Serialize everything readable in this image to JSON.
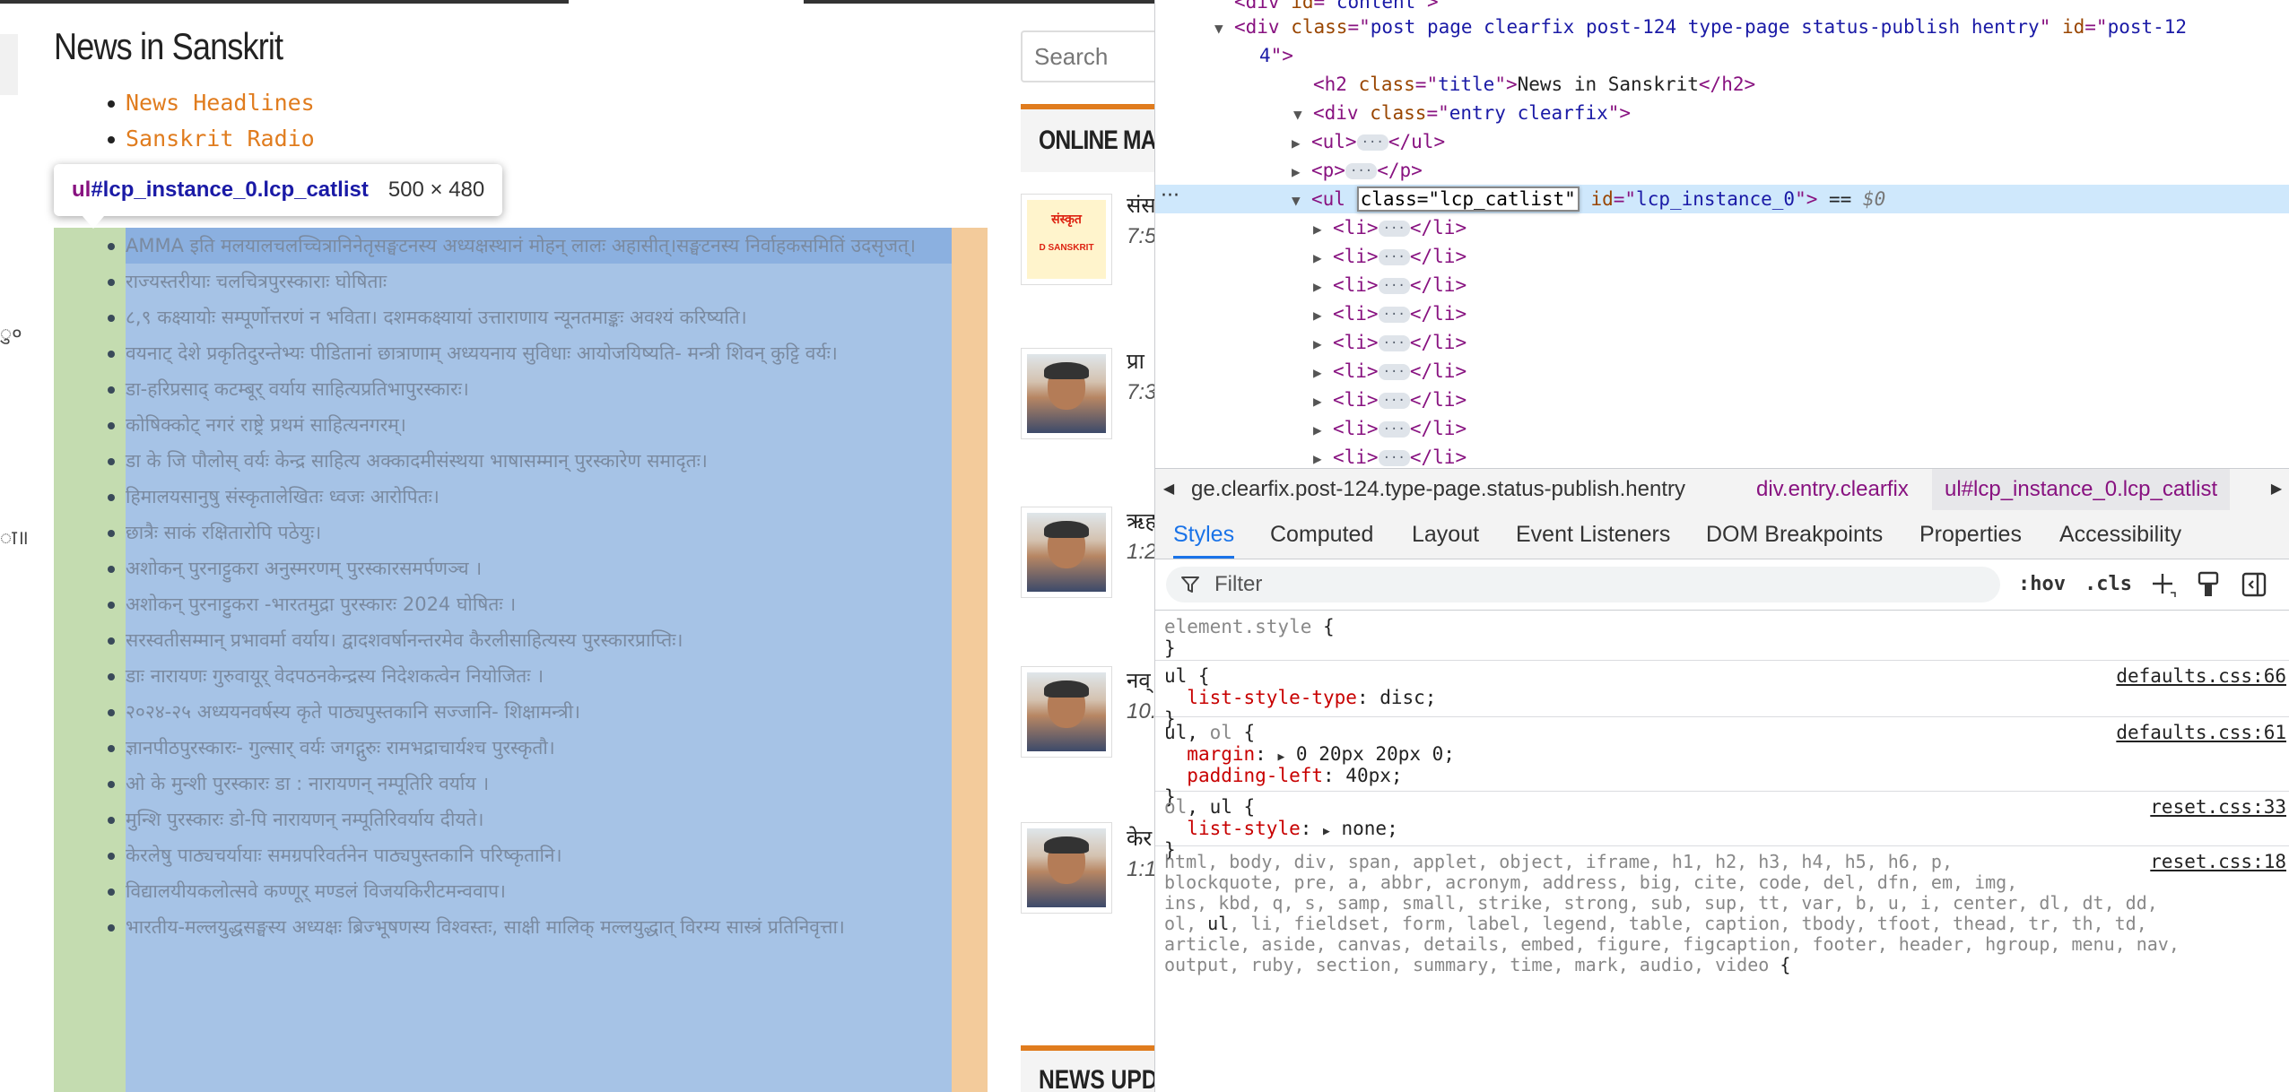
{
  "page": {
    "title": "News in Sanskrit",
    "top_links": [
      "News Headlines",
      "Sanskrit Radio"
    ],
    "edge_glyphs": [
      "ु०",
      "ा॥"
    ],
    "tooltip": {
      "tag": "ul",
      "selector": "#lcp_instance_0.lcp_catlist",
      "size": "500 × 480"
    },
    "cat_list": [
      "AMMA इति मलयालचलच्चित्रानिनेतृसङ्घटनस्य अध्यक्षस्थानं मोहन् लालः अहासीत्।सङ्घटनस्य निर्वाहकसमितिं उदसृजत्।",
      "राज्यस्तरीयाः चलचित्रपुरस्काराः घोषिताः",
      "८,९ कक्ष्यायोः सम्पूर्णोत्तरणं न भविता। दशमकक्ष्यायां उत्ताराणाय न्यूनतमाङ्कः अवश्यं करिष्यति।",
      "वयनाट् देशे प्रकृतिदुरन्तेभ्यः पीडितानां छात्राणाम् अध्ययनाय सुविधाः आयोजयिष्यति- मन्त्री शिवन् कुट्टि वर्यः।",
      "डा-हरिप्रसाद् कटम्बूर् वर्याय साहित्यप्रतिभापुरस्कारः।",
      "कोषिक्कोट् नगरं राष्ट्रे प्रथमं साहित्यनगरम्।",
      "डा के जि पौलोस् वर्यः केन्द्र साहित्य अक्कादमीसंस्थया भाषासम्मान् पुरस्कारेण समादृतः।",
      "हिमालयसानुषु संस्कृतालेखितः ध्वजः आरोपितः।",
      "छात्रैः साकं रक्षितारोपि पठेयुः।",
      "अशोकन् पुरनाट्टुकरा अनुस्मरणम् पुरस्कारसमर्पणञ्च ।",
      "अशोकन् पुरनाट्टुकरा -भारतमुद्रा पुरस्कारः 2024 घोषितः ।",
      "सरस्वतीसम्मान् प्रभावर्मा वर्याय। द्वादशवर्षानन्तरमेव कैरलीसाहित्यस्य पुरस्कारप्राप्तिः।",
      "डाः नारायणः गुरुवायूर् वेदपठनकेन्द्रस्य निदेशकत्वेन नियोजितः ।",
      "२०२४-२५ अध्ययनवर्षस्य कृते पाठ्यपुस्तकानि सज्जानि- शिक्षामन्त्री।",
      "ज्ञानपीठपुरस्कारः- गुल्सार् वर्यः जगद्गुरुः रामभद्राचार्यश्च पुरस्कृतौ।",
      "ओ के मुन्शी पुरस्कारः डा : नारायणन् नम्पूतिरि वर्याय ।",
      "मुन्शि पुरस्कारः डो-पि नारायणन् नम्पूतिरिवर्याय दीयते।",
      "केरलेषु पाठ्यचर्यायाः समग्रपरिवर्तनेन पाठ्यपुस्तकानि परिष्कृतानि।",
      "विद्यालयीयकलोत्सवे कण्णूर् मण्डलं विजयकिरीटमन्ववाप।",
      "भारतीय-मल्लयुद्धसङ्घस्य अध्यक्षः ब्रिज्भूषणस्य विश्वस्तः, साक्षी मालिक् मल्लयुद्धात् विरम्य सास्त्रं प्रतिनिवृत्ता।"
    ],
    "sidebar": {
      "search_placeholder": "Search",
      "online_heading": "ONLINE MA",
      "online_items": [
        {
          "title": "संस",
          "time": "7:5",
          "logo_top": "संस्कृत",
          "logo_bottom": "D SANSKRIT"
        },
        {
          "title": "प्रा",
          "time": "7:3"
        },
        {
          "title": "ऋह",
          "time": "1:2"
        },
        {
          "title": "नव्",
          "time": "10."
        },
        {
          "title": "केर",
          "time": "1:1"
        }
      ],
      "news_heading": "NEWS UPD"
    }
  },
  "devtools": {
    "dom": [
      {
        "indent": 0,
        "tri": "",
        "parts": [
          [
            "tg",
            "<div "
          ],
          [
            "an",
            "id"
          ],
          [
            "tg",
            "=\""
          ],
          [
            "av",
            "content"
          ],
          [
            "tg",
            "\">"
          ]
        ]
      },
      {
        "indent": 0,
        "tri": "▼",
        "parts": [
          [
            "tg",
            "<div "
          ],
          [
            "an",
            "class"
          ],
          [
            "tg",
            "=\""
          ],
          [
            "av",
            "post page clearfix post-124 type-page status-publish hentry"
          ],
          [
            "tg",
            "\" "
          ],
          [
            "an",
            "id"
          ],
          [
            "tg",
            "=\""
          ],
          [
            "av",
            "post-12"
          ]
        ]
      },
      {
        "indent": 1,
        "tri": "",
        "parts": [
          [
            "av",
            "4"
          ],
          [
            "tg",
            "\">"
          ]
        ]
      },
      {
        "indent": 2,
        "tri": "",
        "parts": [
          [
            "tg",
            "<h2 "
          ],
          [
            "an",
            "class"
          ],
          [
            "tg",
            "=\""
          ],
          [
            "av",
            "title"
          ],
          [
            "tg",
            "\">"
          ],
          [
            "tx",
            "News in Sanskrit"
          ],
          [
            "tg",
            "</h2>"
          ]
        ]
      },
      {
        "indent": 2,
        "tri": "▼",
        "parts": [
          [
            "tg",
            "<div "
          ],
          [
            "an",
            "class"
          ],
          [
            "tg",
            "=\""
          ],
          [
            "av",
            "entry clearfix"
          ],
          [
            "tg",
            "\">"
          ]
        ]
      },
      {
        "indent": 3,
        "tri": "▶",
        "parts": [
          [
            "tg",
            "<ul>"
          ],
          [
            "dots",
            "···"
          ],
          [
            "tg",
            "</ul>"
          ]
        ]
      },
      {
        "indent": 3,
        "tri": "▶",
        "parts": [
          [
            "tg",
            "<p>"
          ],
          [
            "dots",
            "···"
          ],
          [
            "tg",
            "</p>"
          ]
        ]
      },
      {
        "indent": 3,
        "tri": "▼",
        "sel": true,
        "parts": [
          [
            "tg",
            "<ul "
          ],
          [
            "edit",
            "class=\"lcp_catlist\""
          ],
          [
            "tg",
            " "
          ],
          [
            "an",
            "id"
          ],
          [
            "tg",
            "=\""
          ],
          [
            "av",
            "lcp_instance_0"
          ],
          [
            "tg",
            "\">"
          ],
          [
            "tx",
            " == "
          ],
          [
            "eq0",
            "$0"
          ]
        ]
      },
      {
        "indent": 4,
        "tri": "▶",
        "parts": [
          [
            "tg",
            "<li>"
          ],
          [
            "dots",
            "···"
          ],
          [
            "tg",
            "</li>"
          ]
        ]
      },
      {
        "indent": 4,
        "tri": "▶",
        "parts": [
          [
            "tg",
            "<li>"
          ],
          [
            "dots",
            "···"
          ],
          [
            "tg",
            "</li>"
          ]
        ]
      },
      {
        "indent": 4,
        "tri": "▶",
        "parts": [
          [
            "tg",
            "<li>"
          ],
          [
            "dots",
            "···"
          ],
          [
            "tg",
            "</li>"
          ]
        ]
      },
      {
        "indent": 4,
        "tri": "▶",
        "parts": [
          [
            "tg",
            "<li>"
          ],
          [
            "dots",
            "···"
          ],
          [
            "tg",
            "</li>"
          ]
        ]
      },
      {
        "indent": 4,
        "tri": "▶",
        "parts": [
          [
            "tg",
            "<li>"
          ],
          [
            "dots",
            "···"
          ],
          [
            "tg",
            "</li>"
          ]
        ]
      },
      {
        "indent": 4,
        "tri": "▶",
        "parts": [
          [
            "tg",
            "<li>"
          ],
          [
            "dots",
            "···"
          ],
          [
            "tg",
            "</li>"
          ]
        ]
      },
      {
        "indent": 4,
        "tri": "▶",
        "parts": [
          [
            "tg",
            "<li>"
          ],
          [
            "dots",
            "···"
          ],
          [
            "tg",
            "</li>"
          ]
        ]
      },
      {
        "indent": 4,
        "tri": "▶",
        "parts": [
          [
            "tg",
            "<li>"
          ],
          [
            "dots",
            "···"
          ],
          [
            "tg",
            "</li>"
          ]
        ]
      },
      {
        "indent": 4,
        "tri": "▶",
        "parts": [
          [
            "tg",
            "<li>"
          ],
          [
            "dots",
            "···"
          ],
          [
            "tg",
            "</li>"
          ]
        ]
      }
    ],
    "breadcrumbs": [
      "ge.clearfix.post-124.type-page.status-publish.hentry",
      "div.entry.clearfix",
      "ul#lcp_instance_0.lcp_catlist"
    ],
    "tabs": [
      "Styles",
      "Computed",
      "Layout",
      "Event Listeners",
      "DOM Breakpoints",
      "Properties",
      "Accessibility"
    ],
    "filter_placeholder": "Filter",
    "hov": ":hov",
    "cls": ".cls",
    "rules": [
      {
        "lines": [
          [
            [
              "sel",
              "element.style"
            ],
            [
              "pv",
              " {"
            ]
          ],
          [
            [
              "pv",
              "}"
            ]
          ]
        ],
        "src": ""
      },
      {
        "lines": [
          [
            [
              "pv",
              "ul {"
            ]
          ],
          [
            [
              "ind",
              "  "
            ],
            [
              "prop",
              "list-style-type"
            ],
            [
              "pv",
              ": disc;"
            ]
          ],
          [
            [
              "pv",
              "}"
            ]
          ]
        ],
        "src": "defaults.css:66"
      },
      {
        "lines": [
          [
            [
              "pv",
              "ul, "
            ],
            [
              "sel",
              "ol"
            ],
            [
              "pv",
              " {"
            ]
          ],
          [
            [
              "ind",
              "  "
            ],
            [
              "prop",
              "margin"
            ],
            [
              "pv",
              ": "
            ],
            [
              "tri",
              "▶"
            ],
            [
              "pv",
              " 0 20px 20px 0;"
            ]
          ],
          [
            [
              "ind",
              "  "
            ],
            [
              "prop",
              "padding-left"
            ],
            [
              "pv",
              ": 40px;"
            ]
          ],
          [
            [
              "pv",
              "}"
            ]
          ]
        ],
        "src": "defaults.css:61"
      },
      {
        "lines": [
          [
            [
              "sel",
              "ol"
            ],
            [
              "pv",
              ", ul {"
            ]
          ],
          [
            [
              "ind",
              "  "
            ],
            [
              "prop",
              "list-style"
            ],
            [
              "pv",
              ": "
            ],
            [
              "tri",
              "▶"
            ],
            [
              "pv",
              " none;"
            ]
          ],
          [
            [
              "pv",
              "}"
            ]
          ]
        ],
        "src": "reset.css:33"
      },
      {
        "lines": [
          [
            [
              "sel",
              "html, body, div, span, applet, object, iframe, h1, h2, h3, h4, h5, h6, p,"
            ]
          ],
          [
            [
              "sel",
              "blockquote, pre, a, abbr, acronym, address, big, cite, code, del, dfn, em, img,"
            ]
          ],
          [
            [
              "sel",
              "ins, kbd, q, s, samp, small, strike, strong, sub, sup, tt, var, b, u, i, center, dl, dt, dd,"
            ]
          ],
          [
            [
              "sel",
              "ol, "
            ],
            [
              "pv",
              "ul"
            ],
            [
              "sel",
              ", li, fieldset, form, label, legend, table, caption, tbody, tfoot, thead, tr, th, td,"
            ]
          ],
          [
            [
              "sel",
              "article, aside, canvas, details, embed, figure, figcaption, footer, header, hgroup, menu, nav,"
            ]
          ],
          [
            [
              "sel",
              "output, ruby, section, summary, time, mark, audio, video"
            ],
            [
              "pv",
              " {"
            ]
          ]
        ],
        "src": "reset.css:18"
      }
    ]
  }
}
